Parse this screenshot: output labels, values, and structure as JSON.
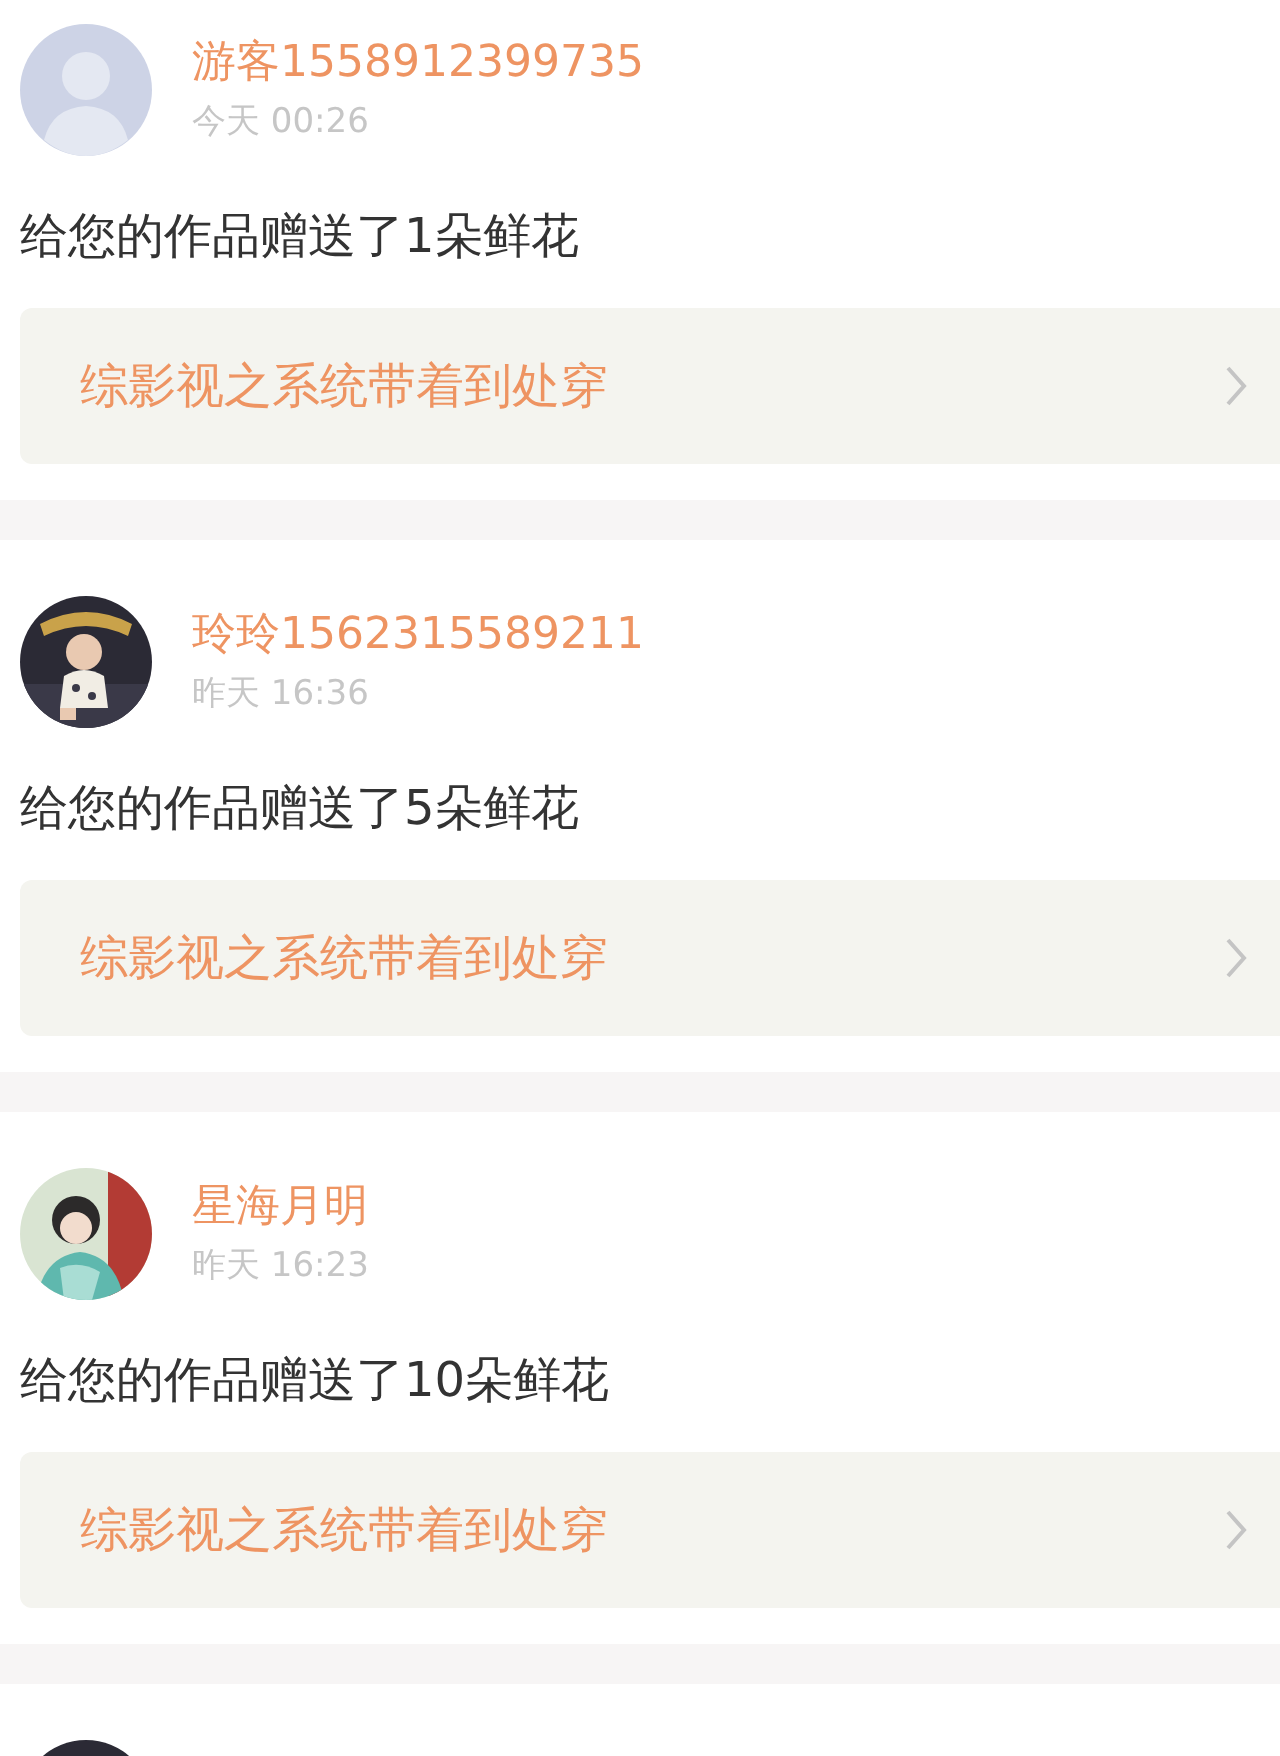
{
  "items": [
    {
      "avatar": {
        "kind": "default"
      },
      "name": "游客1558912399735",
      "time": "今天 00:26",
      "message": "给您的作品赠送了1朵鲜花",
      "link": "综影视之系统带着到处穿"
    },
    {
      "avatar": {
        "kind": "dark"
      },
      "name": "玲玲1562315589211",
      "time": "昨天 16:36",
      "message": "给您的作品赠送了5朵鲜花",
      "link": "综影视之系统带着到处穿"
    },
    {
      "avatar": {
        "kind": "light"
      },
      "name": "星海月明",
      "time": "昨天 16:23",
      "message": "给您的作品赠送了10朵鲜花",
      "link": "综影视之系统带着到处穿"
    },
    {
      "avatar": {
        "kind": "dark"
      }
    }
  ]
}
